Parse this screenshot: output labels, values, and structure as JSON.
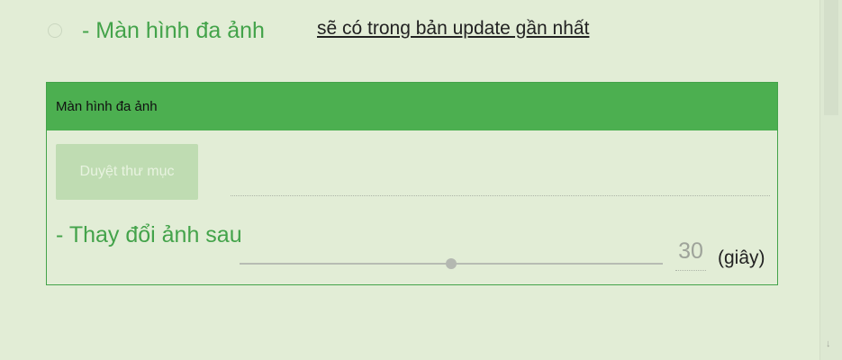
{
  "option": {
    "label": "- Màn hình đa ảnh",
    "selected": false
  },
  "update_notice": "sẽ có trong bản update gần nhất",
  "panel": {
    "title": "Màn hình đa ảnh",
    "browse_button": "Duyệt thư mục",
    "folder_path": "",
    "change_label": "- Thay đổi ảnh sau",
    "interval_seconds": "30",
    "slider_level": 0.5,
    "unit": "(giây)"
  },
  "icons": {
    "scroll_down": "arrow-down-icon"
  },
  "colors": {
    "accent_green": "#4caf50",
    "label_green": "#43a34a",
    "background": "#e2edd6"
  }
}
